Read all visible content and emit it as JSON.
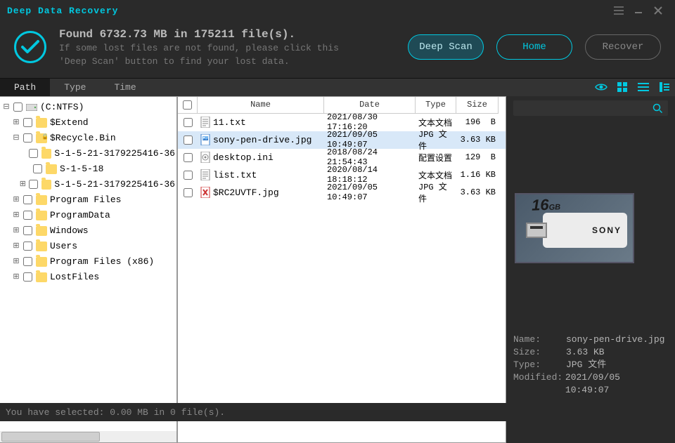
{
  "app_title": "Deep Data Recovery",
  "header": {
    "headline": "Found 6732.73 MB in 175211 file(s).",
    "hint1": "If some lost files are not found, please click this",
    "hint2": "'Deep Scan' button to find your lost data.",
    "buttons": {
      "deep_scan": "Deep Scan",
      "home": "Home",
      "recover": "Recover"
    }
  },
  "tabs": {
    "path": "Path",
    "type": "Type",
    "time": "Time"
  },
  "tree": {
    "root_label": "(C:NTFS)",
    "items": [
      {
        "label": "$Extend",
        "tw": "+",
        "depth": 1
      },
      {
        "label": "$Recycle.Bin",
        "tw": "-",
        "depth": 1,
        "lock": true
      },
      {
        "label": "S-1-5-21-3179225416-36",
        "tw": "",
        "depth": 2
      },
      {
        "label": "S-1-5-18",
        "tw": "",
        "depth": 2
      },
      {
        "label": "S-1-5-21-3179225416-36",
        "tw": "+",
        "depth": 2
      },
      {
        "label": "Program Files",
        "tw": "+",
        "depth": 1
      },
      {
        "label": "ProgramData",
        "tw": "+",
        "depth": 1
      },
      {
        "label": "Windows",
        "tw": "+",
        "depth": 1
      },
      {
        "label": "Users",
        "tw": "+",
        "depth": 1
      },
      {
        "label": "Program Files (x86)",
        "tw": "+",
        "depth": 1
      },
      {
        "label": "LostFiles",
        "tw": "+",
        "depth": 1
      }
    ]
  },
  "columns": {
    "name": "Name",
    "date": "Date",
    "type": "Type",
    "size": "Size"
  },
  "files": [
    {
      "icon": "txt",
      "name": "11.txt",
      "date": "2021/08/30 17:16:20",
      "type": "文本文档",
      "size": "196  B",
      "sel": false
    },
    {
      "icon": "jpg",
      "name": "sony-pen-drive.jpg",
      "date": "2021/09/05 10:49:07",
      "type": "JPG 文件",
      "size": "3.63 KB",
      "sel": true
    },
    {
      "icon": "ini",
      "name": "desktop.ini",
      "date": "2018/08/24 21:54:43",
      "type": "配置设置",
      "size": "129  B",
      "sel": false
    },
    {
      "icon": "txt",
      "name": "list.txt",
      "date": "2020/08/14 18:18:12",
      "type": "文本文档",
      "size": "1.16 KB",
      "sel": false
    },
    {
      "icon": "miss",
      "name": "$RC2UVTF.jpg",
      "date": "2021/09/05 10:49:07",
      "type": "JPG 文件",
      "size": "3.63 KB",
      "sel": false
    }
  ],
  "meta": {
    "name_k": "Name:",
    "name_v": "sony-pen-drive.jpg",
    "size_k": "Size:",
    "size_v": "3.63 KB",
    "type_k": "Type:",
    "type_v": "JPG 文件",
    "mod_k": "Modified:",
    "mod_v": "2021/09/05 10:49:07"
  },
  "preview_caption": {
    "sixteen": "16",
    "gb": "GB",
    "sony": "SONY"
  },
  "status": "You have selected: 0.00 MB in 0 file(s)."
}
